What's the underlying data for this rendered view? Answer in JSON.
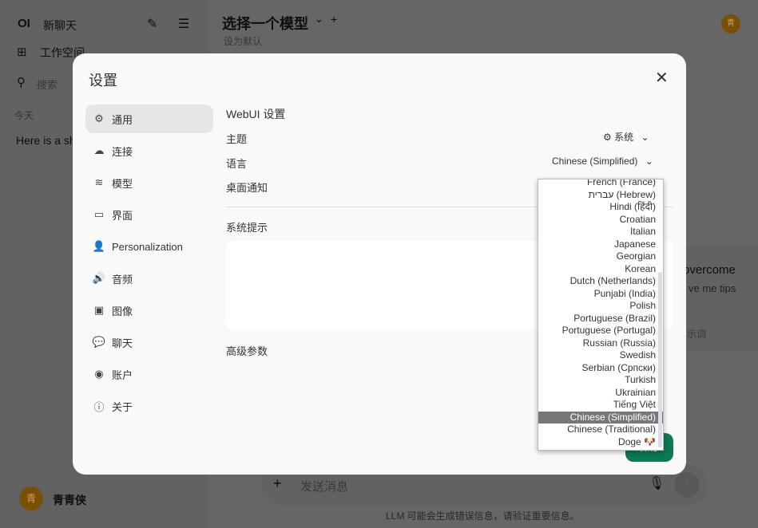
{
  "sidebar": {
    "logo": "OI",
    "new_chat": "新聊天",
    "workspace": "工作空间",
    "search_placeholder": "搜索",
    "section_today": "今天",
    "chat_item": "Here is a short",
    "user_name": "青青侠",
    "avatar_initial": "青"
  },
  "header": {
    "model_select": "选择一个模型",
    "set_default": "设为默认",
    "avatar_initial": "青"
  },
  "main": {
    "suggestion_title": "overcome",
    "suggestion_sub": "ve me tips",
    "prompt_hint": "示词",
    "input_placeholder": "发送消息",
    "disclaimer": "LLM 可能会生成错误信息，请验证重要信息。"
  },
  "modal": {
    "title": "设置",
    "nav": [
      {
        "label": "通用",
        "icon": "gear-icon"
      },
      {
        "label": "连接",
        "icon": "cloud-icon"
      },
      {
        "label": "模型",
        "icon": "database-icon"
      },
      {
        "label": "界面",
        "icon": "monitor-icon"
      },
      {
        "label": "Personalization",
        "icon": "user-icon"
      },
      {
        "label": "音频",
        "icon": "speaker-icon"
      },
      {
        "label": "图像",
        "icon": "image-icon"
      },
      {
        "label": "聊天",
        "icon": "chat-bubble-icon"
      },
      {
        "label": "账户",
        "icon": "account-icon"
      },
      {
        "label": "关于",
        "icon": "info-icon"
      }
    ],
    "section_title": "WebUI 设置",
    "theme_label": "主题",
    "theme_value": "系统",
    "language_label": "语言",
    "language_value": "Chinese (Simplified)",
    "notification_label": "桌面通知",
    "system_prompt_label": "系统提示",
    "advanced_label": "高级参数",
    "save_label": "保存"
  },
  "language_options": [
    "French (France)",
    "עברית (Hebrew)",
    "Hindi (हिंदी)",
    "Croatian",
    "Italian",
    "Japanese",
    "Georgian",
    "Korean",
    "Dutch (Netherlands)",
    "Punjabi (India)",
    "Polish",
    "Portuguese (Brazil)",
    "Portuguese (Portugal)",
    "Russian (Russia)",
    "Swedish",
    "Serbian (Српски)",
    "Turkish",
    "Ukrainian",
    "Tiếng Việt",
    "Chinese (Simplified)",
    "Chinese (Traditional)",
    "Doge 🐶"
  ],
  "selected_language": "Chinese (Simplified)",
  "colors": {
    "accent": "#0b7a55",
    "avatar": "#c47f0a"
  }
}
